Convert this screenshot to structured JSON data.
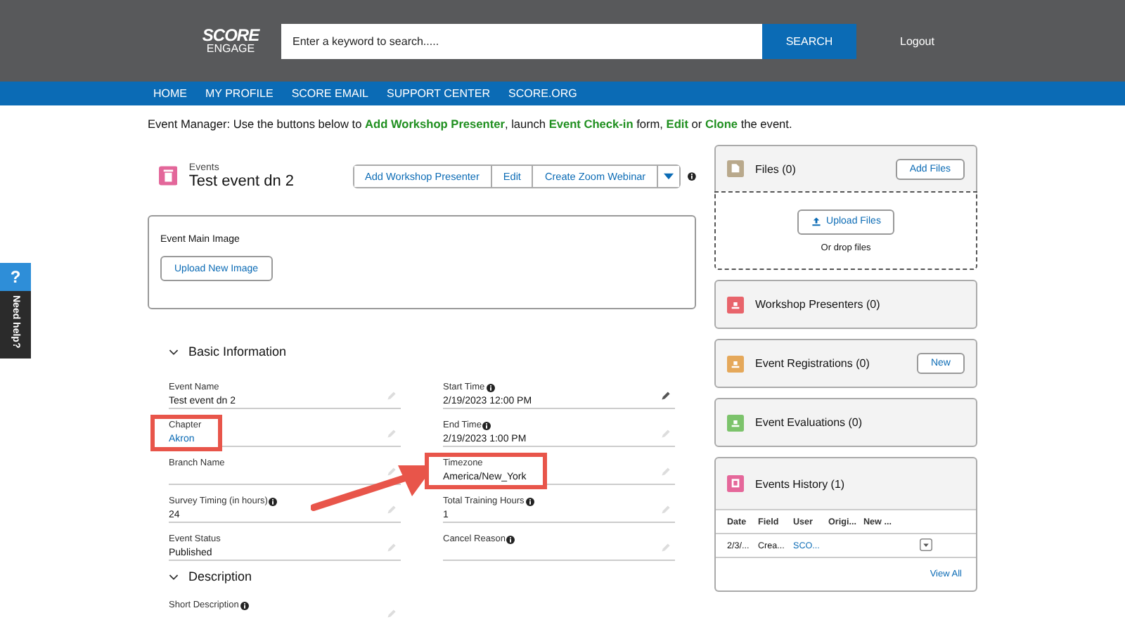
{
  "header": {
    "logo_top": "SCORE",
    "logo_bottom": "ENGAGE",
    "search": {
      "placeholder": "Enter a keyword to search....."
    },
    "search_button": "SEARCH",
    "logout": "Logout"
  },
  "nav": [
    "HOME",
    "MY PROFILE",
    "SCORE EMAIL",
    "SUPPORT CENTER",
    "SCORE.ORG"
  ],
  "intro": "Event Manager: Use the buttons below to **Add Workshop Presenter**, launch **Event Check-in** form, **Edit** or **Clone** the event.",
  "help_tab": {
    "icon": "?",
    "label": "Need help?"
  },
  "record": {
    "object": "Events",
    "title": "Test event dn 2",
    "actions": [
      "Add Workshop Presenter",
      "Edit",
      "Create Zoom Webinar"
    ]
  },
  "image_card": {
    "title": "Event Main Image",
    "button": "Upload New Image"
  },
  "sections": [
    {
      "title": "Basic Information",
      "expanded": true,
      "fields": [
        {
          "label": "Event Name",
          "value": "Test event dn 2"
        },
        {
          "label": "Start Time",
          "value": "2/19/2023 12:00 PM",
          "info": true,
          "hovered": true
        },
        {
          "label": "Chapter",
          "value": "Akron",
          "link": true,
          "highlighted": true
        },
        {
          "label": "End Time",
          "value": "2/19/2023 1:00 PM",
          "info": true
        },
        {
          "label": "Branch Name"
        },
        {
          "label": "Timezone",
          "value": "America/New_York",
          "highlighted": true,
          "arrow": true
        },
        {
          "label": "Survey Timing (in hours)",
          "value": "24",
          "info": true
        },
        {
          "label": "Total Training Hours",
          "value": "1",
          "info": true
        },
        {
          "label": "Event Status",
          "value": "Published"
        },
        {
          "label": "Cancel Reason",
          "info": true
        }
      ]
    },
    {
      "title": "Description",
      "expanded": true,
      "fields": [
        {
          "label": "Short Description",
          "info": true
        }
      ]
    }
  ],
  "panels": [
    {
      "kind": "files",
      "title": "Files (0)",
      "color": "#b9a98c",
      "button": "Add Files",
      "upload_button": "Upload Files",
      "drop_text": "Or drop files"
    },
    {
      "kind": "plain",
      "title": "Workshop Presenters (0)",
      "color": "#e8646b"
    },
    {
      "kind": "plain",
      "title": "Event Registrations (0)",
      "color": "#e5a85a",
      "button": "New"
    },
    {
      "kind": "plain",
      "title": "Event Evaluations (0)",
      "color": "#7cc36b"
    },
    {
      "kind": "table",
      "title": "Events History (1)",
      "color": "#e5679a",
      "columns": [
        "Date",
        "Field",
        "User",
        "Origi...",
        "New ..."
      ],
      "rows": [
        {
          "cells": [
            {
              "text": "2/3/..."
            },
            {
              "text": "Crea..."
            },
            {
              "text": "SCO...",
              "link": true
            }
          ]
        }
      ],
      "footer_link": "View All"
    }
  ]
}
